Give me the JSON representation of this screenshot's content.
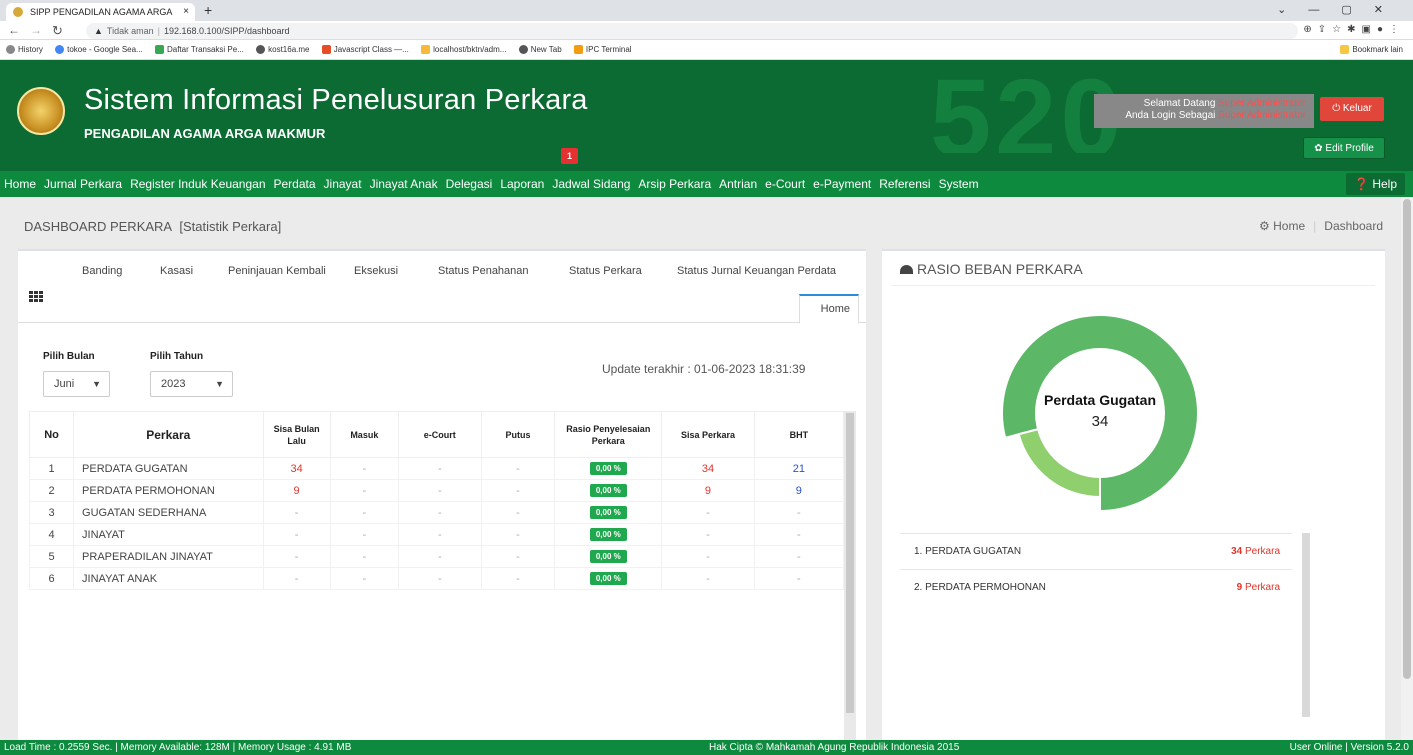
{
  "browser": {
    "tab_title": "SIPP PENGADILAN AGAMA ARGA",
    "tab_close": "×",
    "new_tab": "+",
    "security_label": "Tidak aman",
    "url": "192.168.0.100/SIPP/dashboard",
    "bookmarks": [
      "History",
      "tokoe - Google Sea...",
      "Daftar Transaksi Pe...",
      "kost16a.me",
      "Javascript Class —...",
      "localhost/bktn/adm...",
      "New Tab",
      "IPC Terminal"
    ],
    "bookmark_other": "Bookmark lain"
  },
  "header": {
    "title": "Sistem Informasi Penelusuran Perkara",
    "subtitle": "PENGADILAN AGAMA ARGA MAKMUR",
    "bg_number": "520",
    "welcome_line1": "Selamat Datang",
    "welcome_line2": "Anda Login Sebagai",
    "user_name": "Super Administrator",
    "user_role": "Super Administrator",
    "logout": "Keluar",
    "edit_profile": "Edit Profile"
  },
  "menu": {
    "items": [
      "Home",
      "Jurnal Perkara",
      "Register Induk Keuangan",
      "Perdata",
      "Jinayat",
      "Jinayat Anak",
      "Delegasi",
      "Laporan",
      "Jadwal Sidang",
      "Arsip Perkara",
      "Antrian",
      "e-Court",
      "e-Payment",
      "Referensi",
      "System"
    ],
    "badge": "1",
    "help": "Help"
  },
  "page": {
    "title": "DASHBOARD PERKARA",
    "title_sub": "[Statistik Perkara]",
    "breadcrumb_home": "Home",
    "breadcrumb_current": "Dashboard"
  },
  "tabs": [
    "Banding",
    "Kasasi",
    "Peninjauan Kembali",
    "Eksekusi",
    "Status Penahanan",
    "Status Perkara",
    "Status Jurnal Keuangan Perdata"
  ],
  "home_tab": "Home",
  "filters": {
    "month_label": "Pilih Bulan",
    "month_value": "Juni",
    "year_label": "Pilih Tahun",
    "year_value": "2023",
    "update": "Update terakhir : 01-06-2023 18:31:39"
  },
  "table": {
    "headers": [
      "No",
      "Perkara",
      "Sisa Bulan Lalu",
      "Masuk",
      "e-Court",
      "Putus",
      "Rasio Penyelesaian Perkara",
      "Sisa Perkara",
      "BHT"
    ],
    "rows": [
      [
        "1",
        "PERDATA GUGATAN",
        "34",
        "-",
        "-",
        "-",
        "0,00 %",
        "34",
        "21"
      ],
      [
        "2",
        "PERDATA PERMOHONAN",
        "9",
        "-",
        "-",
        "-",
        "0,00 %",
        "9",
        "9"
      ],
      [
        "3",
        "GUGATAN SEDERHANA",
        "-",
        "-",
        "-",
        "-",
        "0,00 %",
        "-",
        "-"
      ],
      [
        "4",
        "JINAYAT",
        "-",
        "-",
        "-",
        "-",
        "0,00 %",
        "-",
        "-"
      ],
      [
        "5",
        "PRAPERADILAN JINAYAT",
        "-",
        "-",
        "-",
        "-",
        "0,00 %",
        "-",
        "-"
      ],
      [
        "6",
        "JINAYAT ANAK",
        "-",
        "-",
        "-",
        "-",
        "0,00 %",
        "-",
        "-"
      ]
    ]
  },
  "ratio": {
    "title": "RASIO BEBAN PERKARA",
    "center_label": "Perdata Gugatan",
    "center_value": "34",
    "legend": [
      {
        "label": "1. PERDATA GUGATAN",
        "count": "34",
        "unit": "Perkara"
      },
      {
        "label": "2. PERDATA PERMOHONAN",
        "count": "9",
        "unit": "Perkara"
      }
    ]
  },
  "chart_data": {
    "type": "pie",
    "categories": [
      "PERDATA GUGATAN",
      "PERDATA PERMOHONAN"
    ],
    "values": [
      34,
      9
    ],
    "colors": [
      "#5cb767",
      "#8fcf6d"
    ]
  },
  "footer": {
    "left": "Load Time : 0.2559 Sec. | Memory Available: 128M | Memory Usage : 4.91 MB",
    "center": "Hak Cipta © Mahkamah Agung Republik Indonesia 2015",
    "right": "User Online | Version 5.2.0"
  },
  "colors": {
    "brand_dark": "#0b6b33",
    "brand": "#0e8a3f",
    "danger": "#e0473a",
    "success": "#1fa84d"
  }
}
